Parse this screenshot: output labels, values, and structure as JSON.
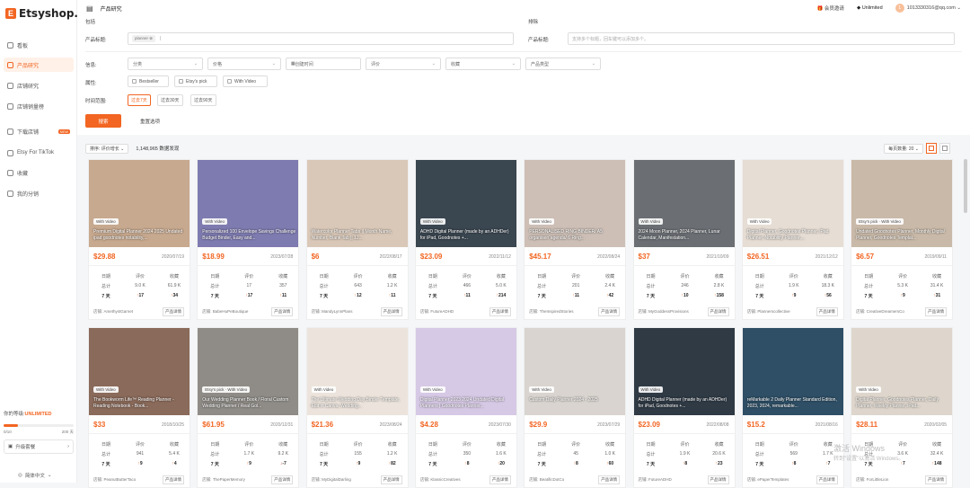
{
  "app": {
    "logo": "Etsyshop.ai",
    "logo_letter": "E"
  },
  "sidebar": {
    "items": [
      {
        "label": "看板",
        "new": ""
      },
      {
        "label": "产品研究",
        "new": ""
      },
      {
        "label": "店铺研究",
        "new": ""
      },
      {
        "label": "店铺销量榜",
        "new": ""
      },
      {
        "label": "下载店铺",
        "new": "NEW"
      },
      {
        "label": "Etsy For TikTok",
        "new": ""
      },
      {
        "label": "收藏",
        "new": ""
      },
      {
        "label": "我的分销",
        "new": ""
      }
    ],
    "account": {
      "prefix": "你的等级:",
      "level": "UNLIMITED"
    },
    "progress": {
      "fraction": 0.2,
      "min": "0/10",
      "max": "200 天"
    },
    "upgrade": "升级套餐",
    "lang": "简体中文"
  },
  "header": {
    "title": "产品研究",
    "fav": "会员邀请",
    "unlimited": "Unlimited",
    "user": "1013330316@qq.com",
    "avatar": "1"
  },
  "filters": {
    "section_left": "包括",
    "section_right": "排除",
    "kw_label": "产品标题:",
    "kw_tag": "planner",
    "ex_label": "产品标题:",
    "ex_placeholder": "支持多个标题，回车键可以添加多个。",
    "info_label": "信息:",
    "selects": [
      "分类",
      "价格",
      "创建时间",
      "评价",
      "收藏",
      "产品类型"
    ],
    "attr_label": "属性:",
    "attrs": [
      "Bestseller",
      "Etsy's pick",
      "With Video"
    ],
    "time_label": "时间范围:",
    "times": [
      "过去7天",
      "过去30天",
      "过去90天"
    ],
    "search": "搜索",
    "reset": "重置选项"
  },
  "results": {
    "sort": "排序: 评价增长",
    "count": "1,148,965 数据发现",
    "per_page": "每页数量: 20"
  },
  "stat_headers": [
    "日期",
    "评价",
    "收藏"
  ],
  "row_total": "总计",
  "row_7d": "7 天",
  "detail_btn": "产品详情",
  "shop_prefix": "店铺: ",
  "colors": {
    "accent": "#f26522"
  },
  "products": [
    {
      "badge": "With Video",
      "title": "Premium Digital Planner 2024 2025 Undated ipad goodnotes notability,...",
      "price": "$29.88",
      "date": "2020/07/19",
      "total_rev": "9.0 K",
      "total_fav": "61.9 K",
      "r7": "17",
      "f7": "34",
      "shop": "AmethystGarnet",
      "bg": "#c7a98f"
    },
    {
      "badge": "With Video",
      "title": "Personalized 100 Envelope Savings Challenge Budget Binder, Easy and...",
      "price": "$18.99",
      "date": "2023/07/28",
      "total_rev": "17",
      "total_fav": "357",
      "r7": "17",
      "f7": "11",
      "shop": "BabeHuPeBoutique",
      "bg": "#7e7bb0"
    },
    {
      "badge": "",
      "title": "Watercolor Planner Tabs || Month Name, Number, Blank Tab || 12...",
      "price": "$6",
      "date": "2022/08/17",
      "total_rev": "643",
      "total_fav": "1.2 K",
      "r7": "12",
      "f7": "11",
      "shop": "MandyLynnPlans",
      "bg": "#d9c8b8"
    },
    {
      "badge": "With Video",
      "title": "ADHD Digital Planner (made by an ADHDer) for iPad, Goodnotes +...",
      "price": "$23.09",
      "date": "2022/11/12",
      "total_rev": "466",
      "total_fav": "5.0 K",
      "r7": "11",
      "f7": "214",
      "shop": "FutureADHD",
      "bg": "#3a4650"
    },
    {
      "badge": "With Video",
      "title": "PERSONALISED RING BINDER/ A5 organiser/ agenda/ 6 Ring...",
      "price": "$45.17",
      "date": "2022/08/24",
      "total_rev": "201",
      "total_fav": "2.4 K",
      "r7": "11",
      "f7": "42",
      "shop": "TheInspiredStories",
      "bg": "#cdbfb6"
    },
    {
      "badge": "With Video",
      "title": "2024 Moon Planner, 2024 Planner, Lunar Calendar, Manifestation...",
      "price": "$37",
      "date": "2021/10/09",
      "total_rev": "246",
      "total_fav": "2.8 K",
      "r7": "10",
      "f7": "158",
      "shop": "MyGoddessProvisions",
      "bg": "#6b6f74"
    },
    {
      "badge": "With Video",
      "title": "Digital Planner, Goodnotes Planner, iPad Planner, Notability Planner,...",
      "price": "$26.51",
      "date": "2021/12/12",
      "total_rev": "1.9 K",
      "total_fav": "18.3 K",
      "r7": "9",
      "f7": "56",
      "shop": "Plannerscollective",
      "bg": "#e6ddd4"
    },
    {
      "badge": "Etsy's pick · With Video",
      "title": "Undated Goodnotes Planner, Monthly Digital Planner, Goodnotes Templat...",
      "price": "$6.57",
      "date": "2019/09/11",
      "total_rev": "5.3 K",
      "total_fav": "31.4 K",
      "r7": "9",
      "f7": "31",
      "shop": "CreativeDreamersCo",
      "bg": "#c9b9a8"
    },
    {
      "badge": "With Video",
      "title": "The Bookworm Life™ Reading Planner - Reading Notebook - Book...",
      "price": "$33",
      "date": "2018/10/25",
      "total_rev": "941",
      "total_fav": "5.4 K",
      "r7": "9",
      "f7": "4",
      "shop": "PeanutButterTaco",
      "bg": "#8a6a5a"
    },
    {
      "badge": "Etsy's pick · With Video",
      "title": "Our Wedding Planner Book / Floral Custom Wedding Planner / Real Gol...",
      "price": "$61.95",
      "date": "2020/12/31",
      "total_rev": "1.7 K",
      "total_fav": "9.2 K",
      "r7": "9",
      "f7": "-7",
      "shop": "ThePaperMemory",
      "bg": "#8f8c87"
    },
    {
      "badge": "With Video",
      "title": "The Ultimate Wedding Day Binder Template, Edit in Canva, Wedding...",
      "price": "$21.36",
      "date": "2023/08/24",
      "total_rev": "155",
      "total_fav": "1.2 K",
      "r7": "9",
      "f7": "82",
      "shop": "MyDigitalDarling",
      "bg": "#ece4dc"
    },
    {
      "badge": "With Video",
      "title": "Digital Planner 2023 2024 Undated Digital Planners | Goodnotes Planner...",
      "price": "$4.28",
      "date": "2023/07/30",
      "total_rev": "350",
      "total_fav": "1.6 K",
      "r7": "8",
      "f7": "20",
      "shop": "KlassicCreatives",
      "bg": "#d6c9e5"
    },
    {
      "badge": "With Video",
      "title": "Custom Daily Planner 2024 - 2025",
      "price": "$29.9",
      "date": "2023/07/29",
      "total_rev": "45",
      "total_fav": "1.0 K",
      "r7": "8",
      "f7": "60",
      "shop": "BeatificDotCo",
      "bg": "#d9d4cf"
    },
    {
      "badge": "With Video",
      "title": "ADHD Digital Planner (made by an ADHDer) for iPad, Goodnotes +...",
      "price": "$23.09",
      "date": "2022/08/08",
      "total_rev": "1.9 K",
      "total_fav": "20.6 K",
      "r7": "8",
      "f7": "23",
      "shop": "FutureADHD",
      "bg": "#2f3a45"
    },
    {
      "badge": "",
      "title": "reMarkable 2 Daily Planner Standard Edition, 2023, 2024, remarkable...",
      "price": "$15.2",
      "date": "2021/08/16",
      "total_rev": "569",
      "total_fav": "1.7 K",
      "r7": "8",
      "f7": "7",
      "shop": "ePaperTemplates",
      "bg": "#2e4f66"
    },
    {
      "badge": "With Video",
      "title": "Digital Planner, Goodnotes Planner, Daily Planner, Weekly Planner, iPad...",
      "price": "$28.11",
      "date": "2020/02/05",
      "total_rev": "3.6 K",
      "total_fav": "32.4 K",
      "r7": "7",
      "f7": "148",
      "shop": "ForLittleLion",
      "bg": "#ded6cc"
    }
  ],
  "watermark": {
    "line1": "激活 Windows",
    "line2": "转到\"设置\"以激活 Windows。"
  }
}
